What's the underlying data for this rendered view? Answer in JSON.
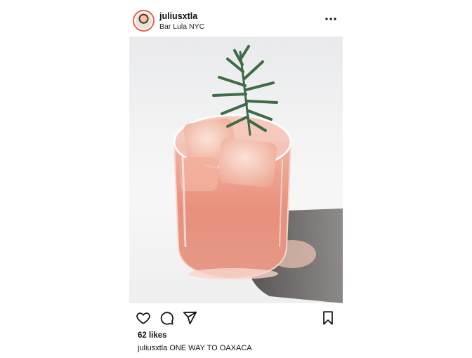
{
  "header": {
    "username": "juliusxtla",
    "location": "Bar Lula NYC",
    "avatar_icon": "profile-avatar",
    "more_icon": "more-horizontal-icon"
  },
  "photo": {
    "subject": "cocktail-with-rosemary-garnish-image"
  },
  "actions": {
    "like_icon": "heart-icon",
    "comment_icon": "comment-icon",
    "share_icon": "send-icon",
    "save_icon": "bookmark-icon"
  },
  "likes": "62 likes",
  "caption": {
    "username": "juliusxtla",
    "text": "ONE WAY TO OAXACA"
  },
  "colors": {
    "avatar_ring": "#e8604a",
    "text": "#111111",
    "drink": "#e69a86"
  }
}
